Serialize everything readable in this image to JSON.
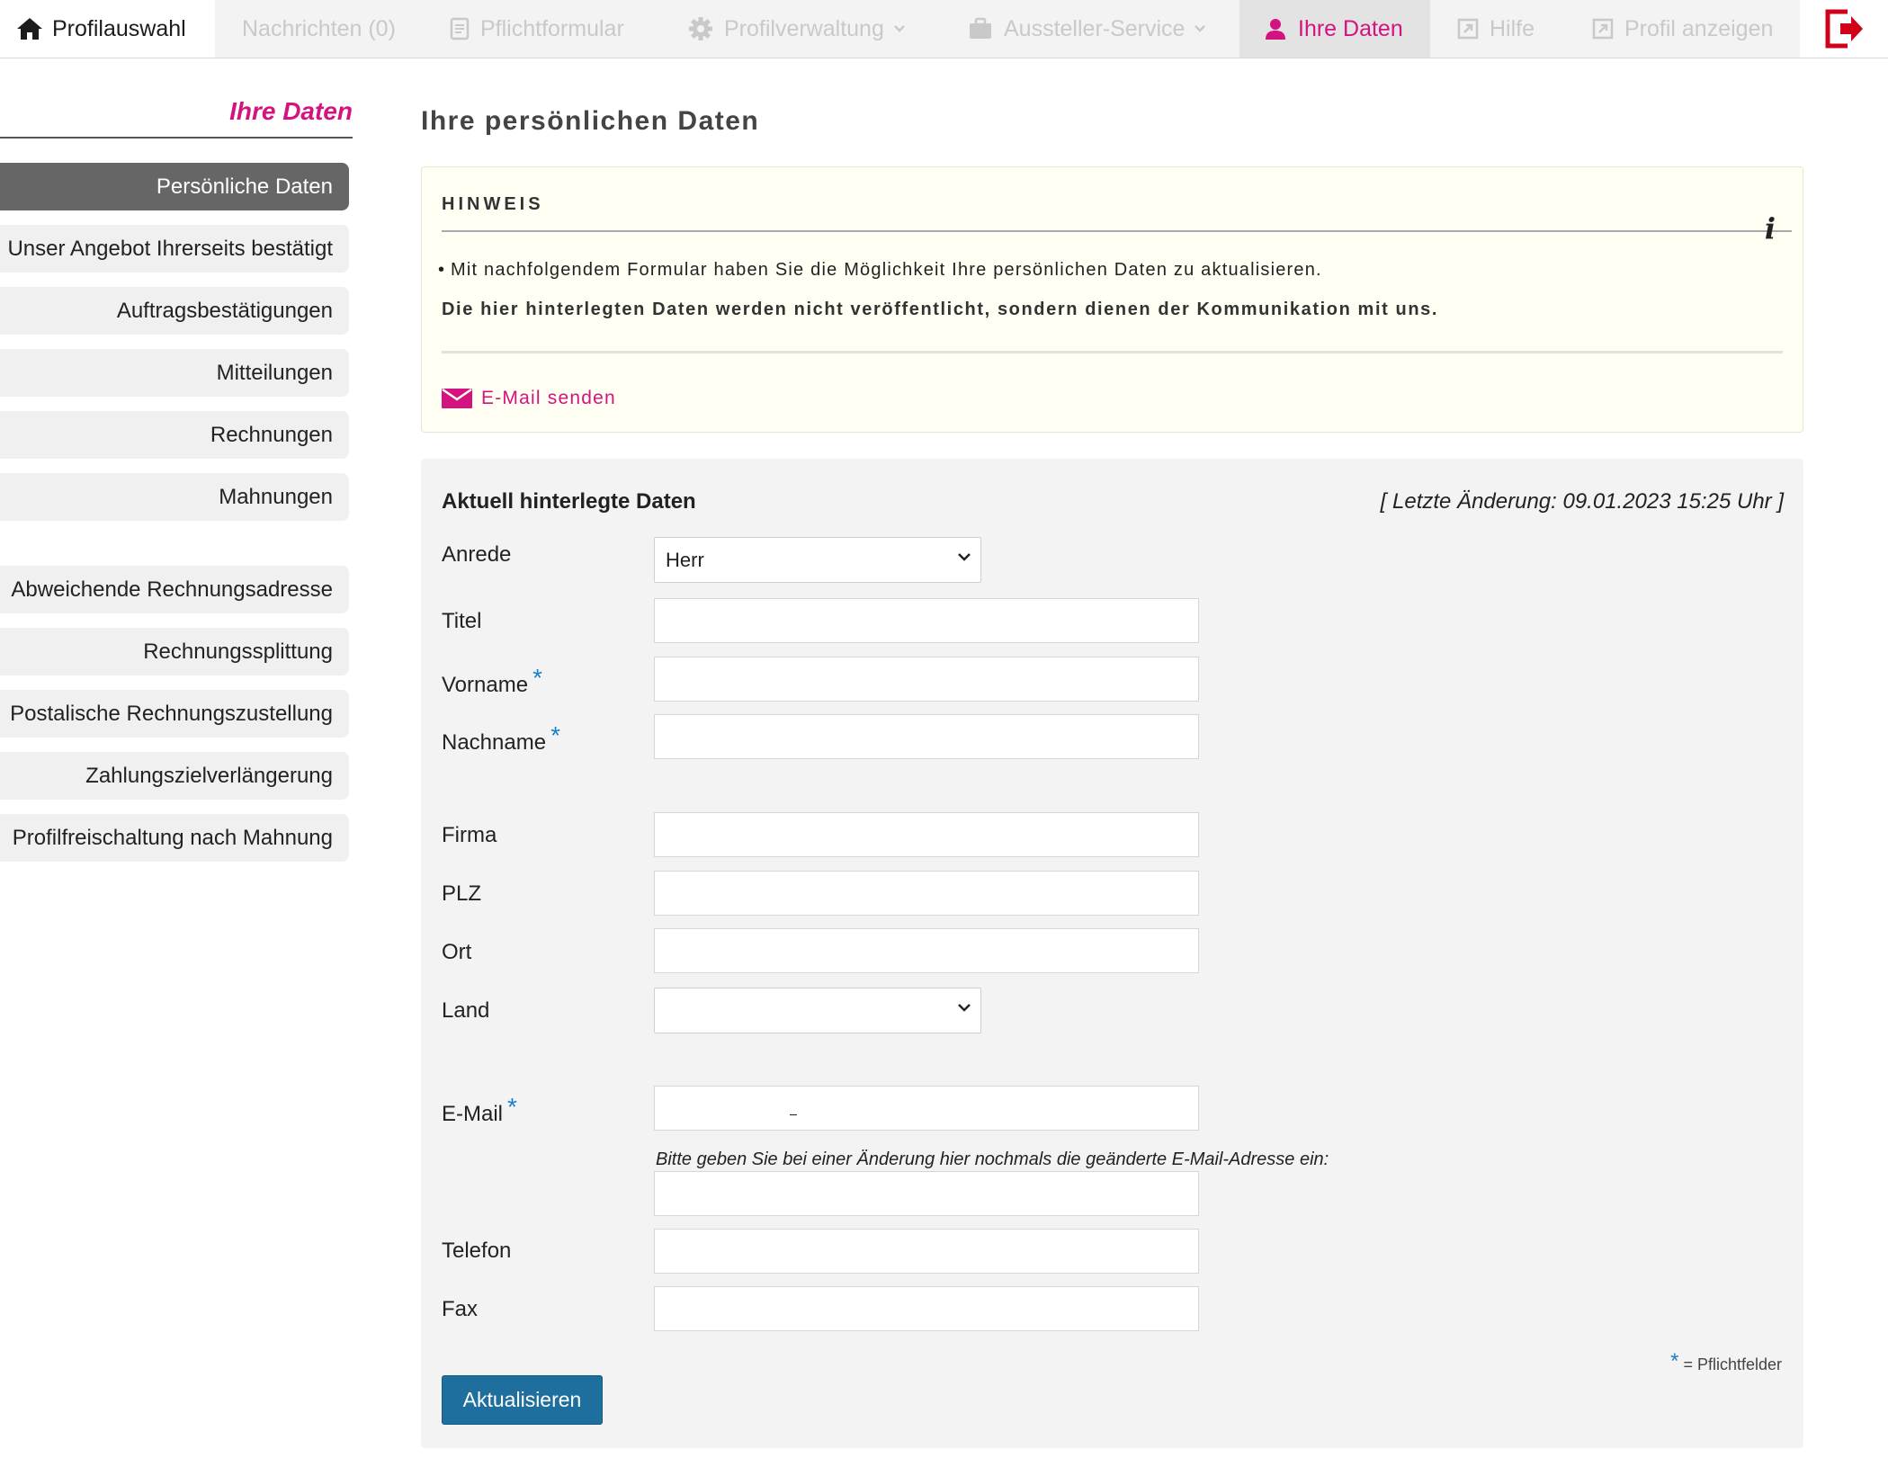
{
  "nav": {
    "home_label": "Profilauswahl",
    "messages_label": "Nachrichten (0)",
    "form_label": "Pflichtformular",
    "profile_admin_label": "Profilverwaltung",
    "exhibitor_service_label": "Aussteller-Service",
    "your_data_label": "Ihre Daten",
    "help_label": "Hilfe",
    "show_profile_label": "Profil anzeigen"
  },
  "sidebar": {
    "title": "Ihre Daten",
    "items": [
      {
        "label": "Persönliche Daten"
      },
      {
        "label": "Unser Angebot Ihrerseits bestätigt"
      },
      {
        "label": "Auftragsbestätigungen"
      },
      {
        "label": "Mitteilungen"
      },
      {
        "label": "Rechnungen"
      },
      {
        "label": "Mahnungen"
      },
      {
        "label": "Abweichende Rechnungsadresse"
      },
      {
        "label": "Rechnungssplittung"
      },
      {
        "label": "Postalische Rechnungszustellung"
      },
      {
        "label": "Zahlungszielverlängerung"
      },
      {
        "label": "Profilfreischaltung nach Mahnung"
      }
    ]
  },
  "main": {
    "page_title": "Ihre persönlichen Daten",
    "hint": {
      "heading": "HINWEIS",
      "bullet": "Mit nachfolgendem Formular haben Sie die Möglichkeit Ihre persönlichen Daten zu aktualisieren.",
      "bold_note": "Die hier hinterlegten Daten werden nicht veröffentlicht, sondern dienen der Kommunikation mit uns.",
      "mail_link": "E-Mail senden"
    },
    "form": {
      "title": "Aktuell hinterlegte Daten",
      "last_change": "[ Letzte Änderung: 09.01.2023 15:25 Uhr ]",
      "labels": {
        "anrede": "Anrede",
        "titel": "Titel",
        "vorname": "Vorname",
        "nachname": "Nachname",
        "firma": "Firma",
        "plz": "PLZ",
        "ort": "Ort",
        "land": "Land",
        "email": "E-Mail",
        "telefon": "Telefon",
        "fax": "Fax"
      },
      "required_mark": "*",
      "anrede_value": "Herr",
      "land_value": "",
      "email_value": "_",
      "email_note": "Bitte geben Sie bei einer Änderung hier nochmals die geänderte E-Mail-Adresse ein:",
      "required_legend": "= Pflichtfelder",
      "submit_label": "Aktualisieren"
    }
  },
  "colors": {
    "accent": "#d3137f",
    "active_sidebar": "#666666",
    "button": "#1f6f9e",
    "required_star": "#1e7fc8",
    "logout_icon": "#d0021b"
  }
}
